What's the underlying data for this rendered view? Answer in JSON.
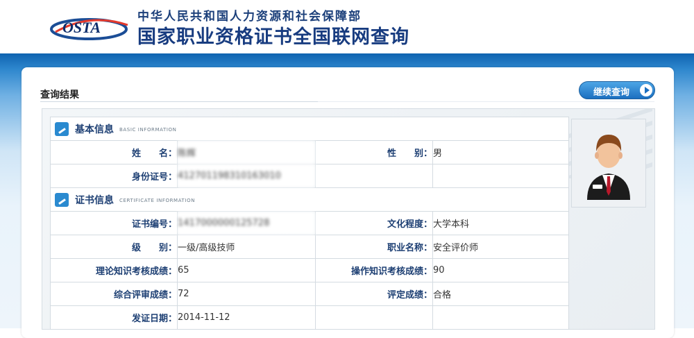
{
  "header": {
    "logo_text": "OSTA",
    "org_name": "中华人民共和国人力资源和社会保障部",
    "system_name": "国家职业资格证书全国联网查询"
  },
  "result": {
    "title": "查询结果",
    "continue_button": "继续查询"
  },
  "basic": {
    "title": "基本信息",
    "subtitle": "BASIC INFORMATION",
    "name_label": "姓　　名：",
    "name_value": "陈辉",
    "gender_label": "性　　别：",
    "gender_value": "男",
    "id_label": "身份证号：",
    "id_value": "412701198310163010"
  },
  "cert": {
    "title": "证书信息",
    "subtitle": "CERTIFICATE INFORMATION",
    "no_label": "证书编号：",
    "no_value": "1417000000125728",
    "edu_label": "文化程度：",
    "edu_value": "大学本科",
    "level_label": "级　　别：",
    "level_value": "一级/高级技师",
    "job_label": "职业名称：",
    "job_value": "安全评价师",
    "theory_label": "理论知识考核成绩：",
    "theory_value": "65",
    "practice_label": "操作知识考核成绩：",
    "practice_value": "90",
    "overall_label": "综合评审成绩：",
    "overall_value": "72",
    "rating_label": "评定成绩：",
    "rating_value": "合格",
    "date_label": "发证日期：",
    "date_value": "2014-11-12"
  }
}
